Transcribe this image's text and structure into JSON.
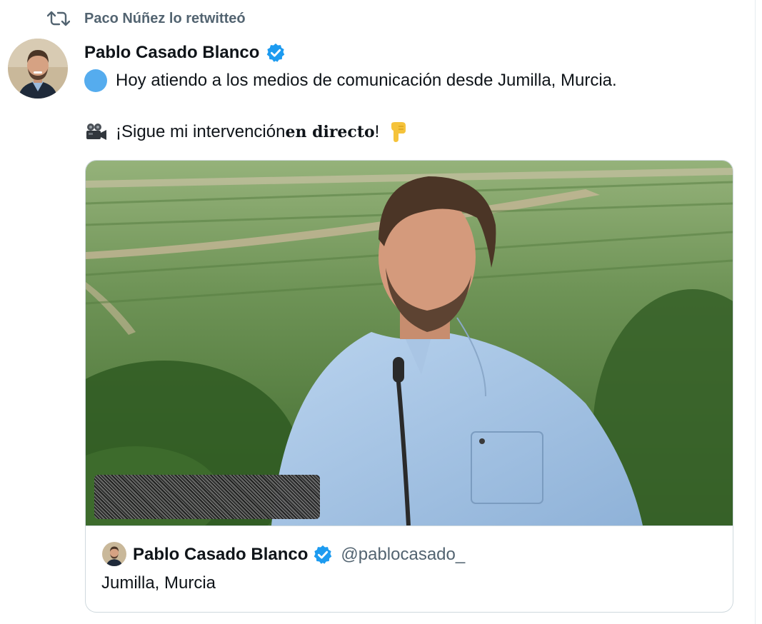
{
  "retweet": {
    "label": "Paco Núñez lo retwitteó",
    "icon": "retweet-icon",
    "color": "#536471"
  },
  "tweet": {
    "author": {
      "name": "Pablo Casado Blanco",
      "verified": true,
      "verified_color": "#1d9bf0"
    },
    "line1": "Hoy atiendo a los medios de comunicación desde Jumilla, Murcia.",
    "line2_prefix": "¡Sigue mi intervención ",
    "line2_bold": "en directo",
    "line2_suffix": "!",
    "icons": [
      "blue-circle-emoji",
      "movie-camera-emoji",
      "pointing-down-emoji"
    ]
  },
  "media_card": {
    "video_icon": "video-thumbnail",
    "quote": {
      "name": "Pablo Casado Blanco",
      "handle": "@pablocasado_",
      "text": "Jumilla, Murcia"
    }
  }
}
